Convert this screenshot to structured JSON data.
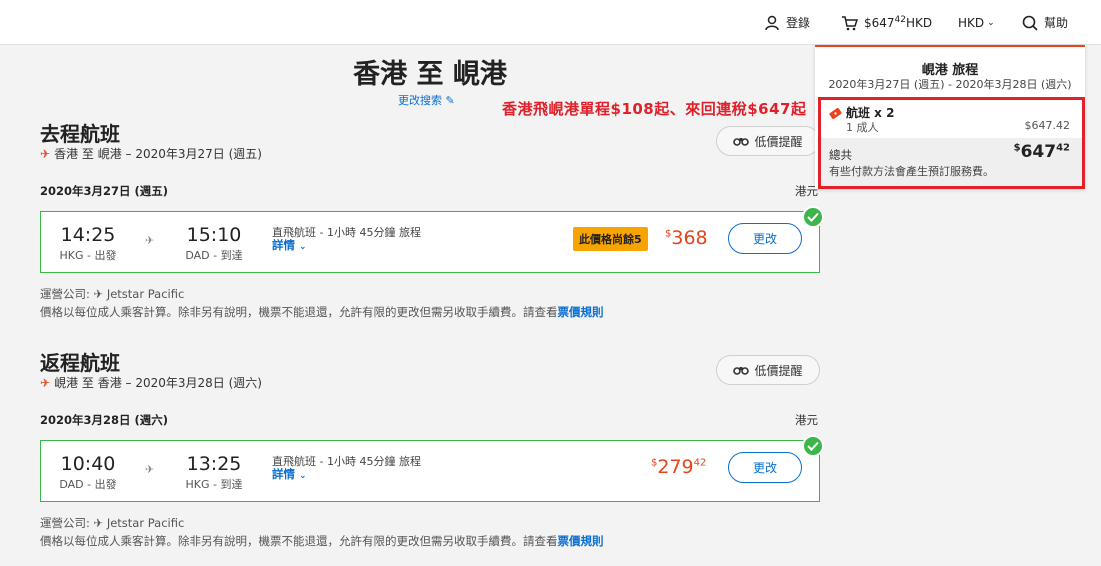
{
  "header": {
    "login": "登錄",
    "cart_amount": "$647",
    "cart_cents": "42",
    "cart_currency": "HKD",
    "currency_select": "HKD",
    "help": "幫助"
  },
  "page": {
    "title": "香港 至 峴港",
    "change_search": "更改搜索",
    "promo": "香港飛峴港單程$108起、來回連稅$647起"
  },
  "outbound": {
    "title": "去程航班",
    "route": "香港 至 峴港 – 2020年3月27日 (週五)",
    "alert": "低價提醒",
    "date_label": "2020年3月27日 (週五)",
    "currency": "港元",
    "depart_time": "14:25",
    "depart_airport": "HKG - 出發",
    "arrive_time": "15:10",
    "arrive_airport": "DAD - 到達",
    "info": "直飛航班 - 1小時 45分鐘 旅程",
    "details": "詳情",
    "badge": "此價格尚餘5",
    "price_symbol": "$",
    "price": "368",
    "price_cents": "",
    "change": "更改",
    "operator": "運營公司: ✈ Jetstar Pacific",
    "note": "價格以每位成人乘客計算。除非另有說明，機票不能退還，允許有限的更改但需另收取手續費。請查看",
    "rules": "票價規則"
  },
  "return": {
    "title": "返程航班",
    "route": "峴港 至 香港 – 2020年3月28日 (週六)",
    "alert": "低價提醒",
    "date_label": "2020年3月28日 (週六)",
    "currency": "港元",
    "depart_time": "10:40",
    "depart_airport": "DAD - 出發",
    "arrive_time": "13:25",
    "arrive_airport": "HKG - 到達",
    "info": "直飛航班 - 1小時 45分鐘 旅程",
    "details": "詳情",
    "price_symbol": "$",
    "price": "279",
    "price_cents": "42",
    "change": "更改",
    "operator": "運營公司: ✈ Jetstar Pacific",
    "note": "價格以每位成人乘客計算。除非另有說明，機票不能退還，允許有限的更改但需另收取手續費。請查看",
    "rules": "票價規則"
  },
  "cart": {
    "title": "峴港 旅程",
    "dates": "2020年3月27日 (週五) - 2020年3月28日 (週六)",
    "flights": "航班 x 2",
    "pax": "1 成人",
    "pax_price": "$647.42",
    "total_label": "總共",
    "total_symbol": "$",
    "total": "647",
    "total_cents": "42",
    "note": "有些付款方法會產生預訂服務費。"
  },
  "colors": {
    "accent": "#e8431a",
    "link": "#0a6fd1",
    "selected": "#3cb54a",
    "promo": "#e0202a",
    "badge": "#f7a300"
  }
}
